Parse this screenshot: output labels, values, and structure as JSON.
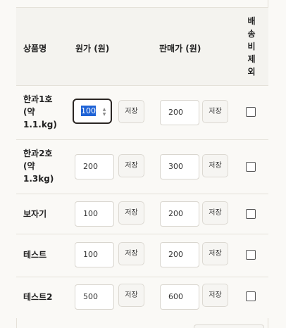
{
  "table": {
    "headers": {
      "name": "상품명",
      "original_price": "원가 (원)",
      "sale_price": "판매가 (원)",
      "exclude_shipping": "배송비제외"
    },
    "save_label": "저장",
    "rows": [
      {
        "name": "한과1호 (약 1.1.kg)",
        "original_price": "100",
        "sale_price": "200",
        "exclude_shipping": false
      },
      {
        "name": "한과2호 (약 1.3kg)",
        "original_price": "200",
        "sale_price": "300",
        "exclude_shipping": false
      },
      {
        "name": "보자기",
        "original_price": "100",
        "sale_price": "200",
        "exclude_shipping": false
      },
      {
        "name": "테스트",
        "original_price": "100",
        "sale_price": "200",
        "exclude_shipping": false
      },
      {
        "name": "테스트2",
        "original_price": "500",
        "sale_price": "600",
        "exclude_shipping": false
      }
    ]
  },
  "focused_input": {
    "selected_text": "100"
  },
  "colors": {
    "selection": "#1f63d6",
    "focus_border": "#2b2623",
    "background": "#faf9f6",
    "header_bg": "#f4f3ef"
  }
}
